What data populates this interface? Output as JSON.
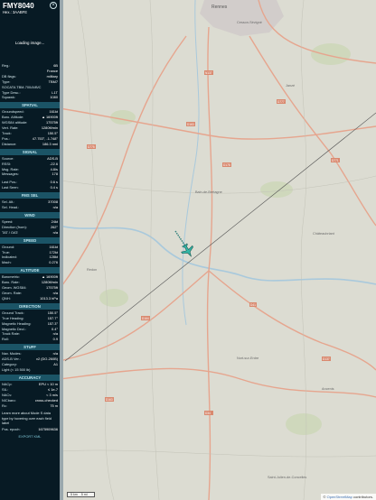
{
  "header": {
    "callsign": "FMY8040",
    "hex_label": "Hex.:",
    "hex_value": "3AABFE"
  },
  "photo": {
    "status": "Loading image..."
  },
  "info_rows": [
    {
      "k": "Reg.:",
      "v": "6B"
    },
    {
      "k": "",
      "v": "France"
    },
    {
      "k": "DB flags:",
      "v": "military"
    },
    {
      "k": "Type:",
      "v": "TBM7"
    },
    {
      "k": "SOCATA TBM-700/A/B/C",
      "v": ""
    },
    {
      "k": "Type Desc.:",
      "v": "L1T"
    },
    {
      "k": "Squawk:",
      "v": "1080"
    }
  ],
  "sections": [
    {
      "title": "SPATIAL",
      "rows": [
        {
          "k": "Groundspeed:",
          "v": "161kt"
        },
        {
          "k": "Baro. Altitude:",
          "v": "▲ 16900ft"
        },
        {
          "k": "WGS84 altitude:",
          "v": "17575ft"
        },
        {
          "k": "Vert. Rate:",
          "v": "1280ft/min"
        },
        {
          "k": "Track:",
          "v": "150.5°"
        },
        {
          "k": "Pos.:",
          "v": "47.753°, -1.748°"
        },
        {
          "k": "Distance:",
          "v": "186.3 nmi"
        }
      ]
    },
    {
      "title": "SIGNAL",
      "rows": [
        {
          "k": "Source:",
          "v": "ADS-B"
        },
        {
          "k": "RSSI:",
          "v": "-22.6"
        },
        {
          "k": "Msg. Rate:",
          "v": "4.8/s"
        },
        {
          "k": "Messages:",
          "v": "178"
        },
        {
          "k": "",
          "v": "",
          "gap": true
        },
        {
          "k": "Last Pos.:",
          "v": "0.6 s"
        },
        {
          "k": "Last Seen:",
          "v": "0.4 s"
        }
      ]
    },
    {
      "title": "FMS SEL",
      "rows": [
        {
          "k": "Sel. Alt.:",
          "v": "37008"
        },
        {
          "k": "Sel. Head.:",
          "v": "n/a"
        }
      ]
    },
    {
      "title": "WIND",
      "rows": [
        {
          "k": "Speed:",
          "v": "24kt"
        },
        {
          "k": "Direction (from):",
          "v": "262°"
        },
        {
          "k": "TAT / OAT:",
          "v": "n/a"
        }
      ]
    },
    {
      "title": "SPEED",
      "rows": [
        {
          "k": "Ground:",
          "v": "161kt"
        },
        {
          "k": "True:",
          "v": "172kt"
        },
        {
          "k": "Indicated:",
          "v": "128kt"
        },
        {
          "k": "Mach:",
          "v": "0.276"
        }
      ]
    },
    {
      "title": "ALTITUDE",
      "rows": [
        {
          "k": "Barometric:",
          "v": "▲ 16900ft"
        },
        {
          "k": "Baro. Rate:",
          "v": "1280ft/min"
        },
        {
          "k": "Geom. WGS84:",
          "v": "17575ft"
        },
        {
          "k": "Geom. Rate:",
          "v": "n/a"
        },
        {
          "k": "QNH:",
          "v": "1013.3 hPa"
        }
      ]
    },
    {
      "title": "DIRECTION",
      "rows": [
        {
          "k": "Ground Track:",
          "v": "150.5°"
        },
        {
          "k": "True Heading:",
          "v": "157.7°"
        },
        {
          "k": "Magnetic Heading:",
          "v": "157.3°"
        },
        {
          "k": "Magnetic Decl.:",
          "v": "0.4°"
        },
        {
          "k": "Track Rate:",
          "v": "n/a"
        },
        {
          "k": "Roll:",
          "v": "0.9"
        }
      ]
    },
    {
      "title": "STUFF",
      "rows": [
        {
          "k": "Nav. Modes:",
          "v": "n/a"
        },
        {
          "k": "ADS-B Ver.:",
          "v": "v2 (DO-260B)"
        },
        {
          "k": "Category:",
          "v": "A1"
        },
        {
          "k": "Light (< 15 500 lb)",
          "v": ""
        }
      ]
    },
    {
      "title": "ACCURACY",
      "rows": [
        {
          "k": "NACp:",
          "v": "EPU < 10 m"
        },
        {
          "k": "SIL:",
          "v": "≤ 1e-7"
        },
        {
          "k": "NACv:",
          "v": "< 3 m/s"
        },
        {
          "k": "NICbaro:",
          "v": "cross-checked"
        },
        {
          "k": "Rc:",
          "v": "75 m"
        }
      ]
    }
  ],
  "footer": {
    "note": "Learn more about Mode S data type by hovering over each field label",
    "pos_epoch_label": "Pos. epoch:",
    "pos_epoch_value": "1675909636",
    "export": "EXPORT KML"
  },
  "map": {
    "city": "Rennes",
    "towns": [
      "Cesson-Sévigné",
      "Janzé",
      "Bain-de-Bretagne",
      "Châteaubriant",
      "Nort-sur-Erdre",
      "Ancenis",
      "Redon",
      "Saint-Julien-de-Concelles"
    ],
    "roads": [
      "N137",
      "D163",
      "D777",
      "D775",
      "D178",
      "D771",
      "D164",
      "D41",
      "D34",
      "D163",
      "D137"
    ],
    "attribution_prefix": "©",
    "attribution_link": "OpenStreetMap",
    "attribution_suffix": "contributors.",
    "scale_labels": [
      "5 km",
      "5 mi"
    ],
    "colors": {
      "track": "#2f7f7a",
      "plane": "#32b7a7",
      "road": "#e6a58e",
      "water": "#a9c9dc",
      "forest": "#cfd8bc"
    }
  }
}
